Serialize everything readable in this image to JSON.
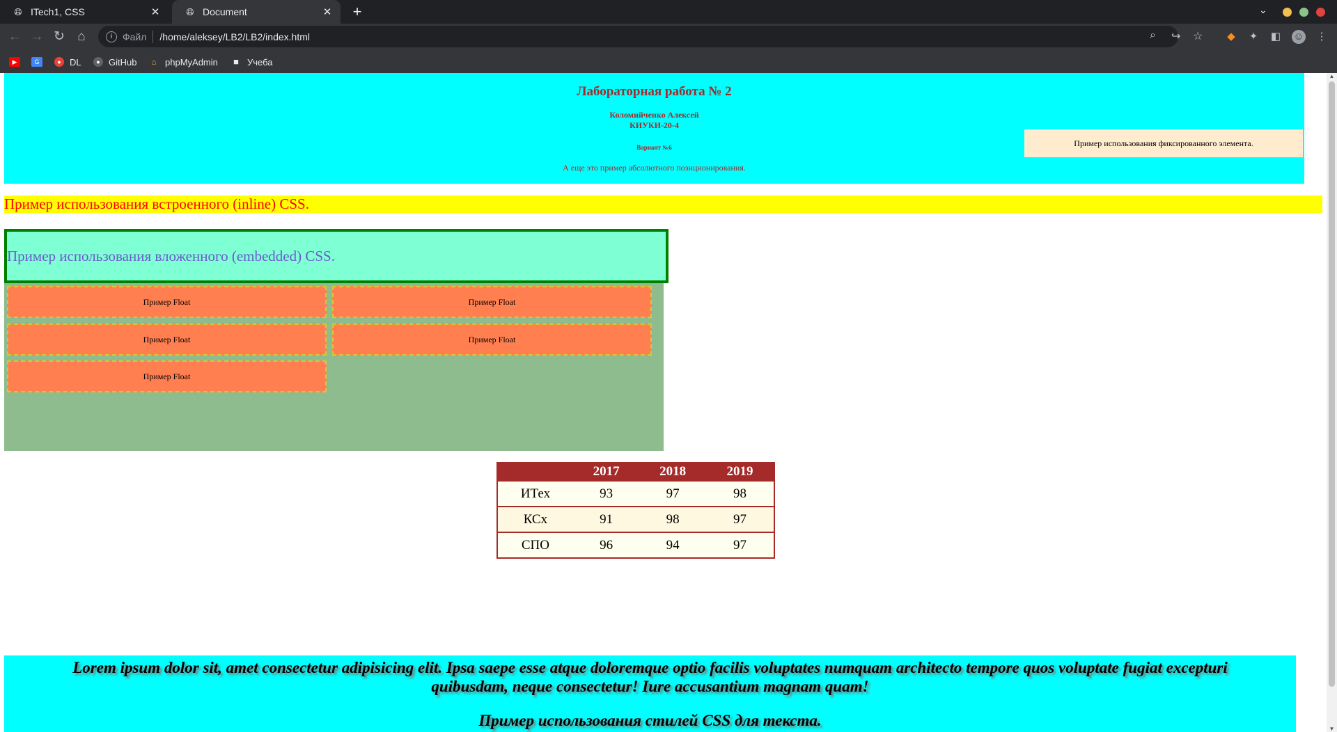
{
  "browser": {
    "tabs": [
      {
        "title": "ITech1, CSS",
        "active": false,
        "icon": "globe-icon"
      },
      {
        "title": "Document",
        "active": true,
        "icon": "globe-icon"
      }
    ],
    "new_tab_symbol": "+",
    "address": {
      "protocol_label": "Файл",
      "url": "/home/aleksey/LB2/LB2/index.html"
    },
    "bookmarks": [
      {
        "label": "",
        "icon": "youtube-icon",
        "color": "#ff0000"
      },
      {
        "label": "",
        "icon": "translate-icon",
        "color": "#4285f4"
      },
      {
        "label": "DL",
        "icon": "dl-icon",
        "color": "#ea4335"
      },
      {
        "label": "GitHub",
        "icon": "github-icon",
        "color": "#e8eaed"
      },
      {
        "label": "phpMyAdmin",
        "icon": "phpmyadmin-icon",
        "color": "#f0a030"
      },
      {
        "label": "Учеба",
        "icon": "folder-icon",
        "color": "#e8eaed"
      }
    ],
    "window_controls": {
      "minimize": "#f4bf4f",
      "maximize": "#8bc48a",
      "close": "#e0443e"
    }
  },
  "page": {
    "header": {
      "title": "Лабораторная работа № 2",
      "author": "Коломийченко Алексей",
      "group": "КИУКИ-20-4",
      "variant": "Вариант №6",
      "absolute_note": "А еще это пример абсолютного позиционирования."
    },
    "fixed_note": "Пример использования фиксированного элемента.",
    "inline_css": "Пример использования встроенного (inline) CSS.",
    "embedded_css": "Пример использования вложенного (embedded) CSS.",
    "floats": [
      "Пример Float",
      "Пример Float",
      "Пример Float",
      "Пример Float",
      "Пример Float"
    ],
    "table": {
      "headers": [
        "",
        "2017",
        "2018",
        "2019"
      ],
      "rows": [
        [
          "ИТех",
          "93",
          "97",
          "98"
        ],
        [
          "КСх",
          "91",
          "98",
          "97"
        ],
        [
          "СПО",
          "96",
          "94",
          "97"
        ]
      ]
    },
    "footer": {
      "lorem": "Lorem ipsum dolor sit, amet consectetur adipisicing elit. Ipsa saepe esse atque doloremque optio facilis voluptates numquam architecto tempore quos voluptate fugiat excepturi quibusdam, neque consectetur! Iure accusantium magnam quam!",
      "css_text": "Пример использования стилей CSS для текста."
    },
    "colors": {
      "header_bg": "#00ffff",
      "header_text": "#a52a2a",
      "fixed_bg": "#ffebcd",
      "inline_bg": "#ffff00",
      "inline_text": "#ff0000",
      "embedded_bg": "#7fffd4",
      "embedded_border": "#008000",
      "embedded_text": "#6a5acd",
      "float_container_bg": "#8fbc8f",
      "float_item_bg": "#ff7f50",
      "table_accent": "#a52a2a"
    }
  }
}
